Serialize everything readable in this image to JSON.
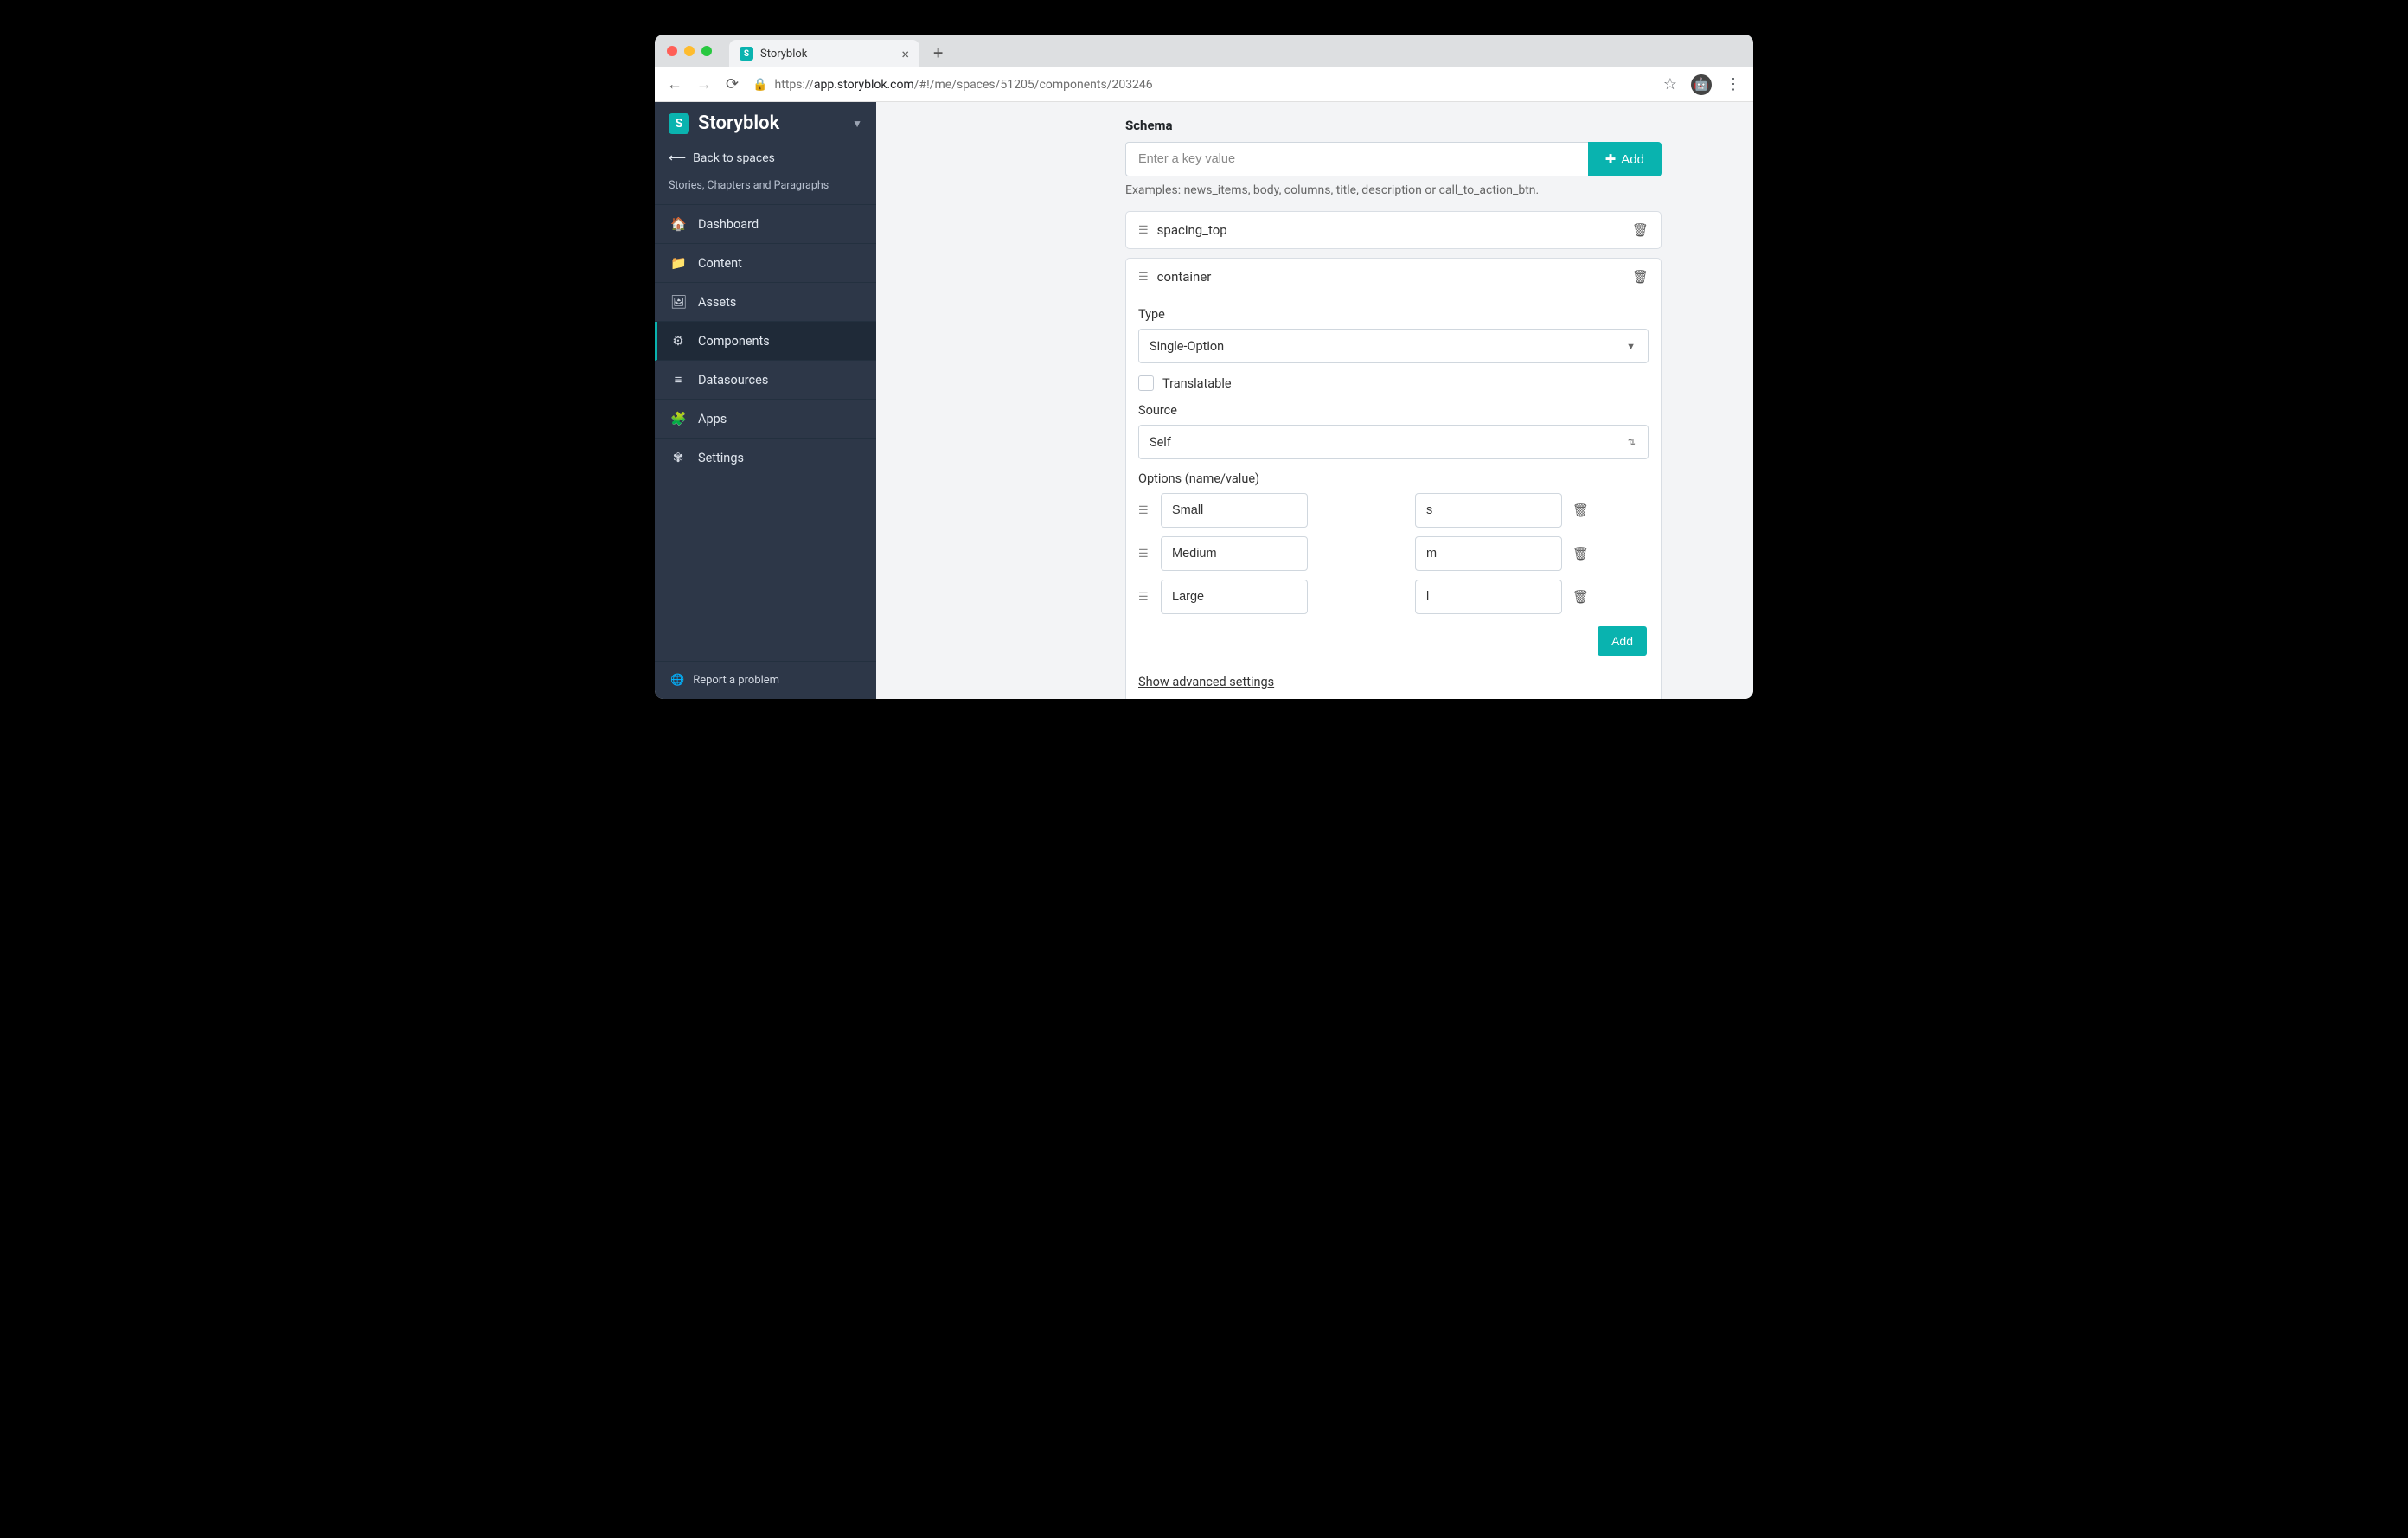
{
  "browser": {
    "tab_title": "Storyblok",
    "url_host": "app.storyblok.com",
    "url_path": "/#!/me/spaces/51205/components/203246"
  },
  "sidebar": {
    "brand": "Storyblok",
    "back": "Back to spaces",
    "space": "Stories, Chapters and Paragraphs",
    "items": [
      {
        "label": "Dashboard",
        "icon": "🏠"
      },
      {
        "label": "Content",
        "icon": "📁"
      },
      {
        "label": "Assets",
        "icon": "🖼"
      },
      {
        "label": "Components",
        "icon": "⚙",
        "active": true
      },
      {
        "label": "Datasources",
        "icon": "≡"
      },
      {
        "label": "Apps",
        "icon": "🧩"
      },
      {
        "label": "Settings",
        "icon": "✾"
      }
    ],
    "report": "Report a problem"
  },
  "schema": {
    "title": "Schema",
    "key_placeholder": "Enter a key value",
    "add_label": "Add",
    "examples": "Examples: news_items, body, columns, title, description or call_to_action_btn.",
    "fields": [
      {
        "name": "spacing_top"
      },
      {
        "name": "container",
        "expanded": true
      }
    ],
    "detail": {
      "type_label": "Type",
      "type_value": "Single-Option",
      "translatable_label": "Translatable",
      "source_label": "Source",
      "source_value": "Self",
      "options_label": "Options (name/value)",
      "options": [
        {
          "name": "Small",
          "value": "s"
        },
        {
          "name": "Medium",
          "value": "m"
        },
        {
          "name": "Large",
          "value": "l"
        }
      ],
      "add_option": "Add",
      "advanced": "Show advanced settings"
    }
  }
}
